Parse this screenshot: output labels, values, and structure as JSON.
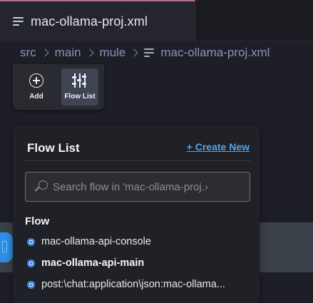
{
  "tab": {
    "title": "mac-ollama-proj.xml",
    "icon": "file-lines-icon"
  },
  "breadcrumb": {
    "items": [
      "src",
      "main",
      "mule"
    ],
    "file": "mac-ollama-proj.xml",
    "separator_icon": "chevron-right-icon",
    "file_icon": "file-lines-icon"
  },
  "toolbar": {
    "add_label": "Add",
    "flowlist_label": "Flow List"
  },
  "panel": {
    "title": "Flow List",
    "create_new": "+ Create New",
    "search_placeholder": "Search flow in 'mac-ollama-proj.›",
    "section_label": "Flow",
    "flows": [
      {
        "label": "mac-ollama-api-console",
        "selected": false
      },
      {
        "label": "mac-ollama-api-main",
        "selected": true
      },
      {
        "label": "post:\\chat:application\\json:mac-ollama...",
        "selected": false
      }
    ]
  },
  "colors": {
    "accent_link": "#5aa2e6",
    "tab_top_border": "#b16b8f",
    "flow_icon": "#3f86e0",
    "canvas_band": "#3b4148"
  }
}
